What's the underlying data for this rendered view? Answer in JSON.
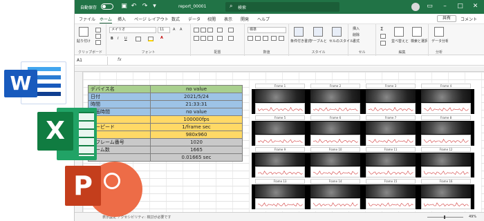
{
  "window": {
    "autosave_label": "自動保存",
    "autosave_state": "オフ",
    "filename": "report_00001",
    "search_placeholder": "検索",
    "share_label": "共有",
    "comment_label": "コメント"
  },
  "tabs": [
    "ファイル",
    "ホーム",
    "挿入",
    "ページ レイアウト",
    "数式",
    "データ",
    "校閲",
    "表示",
    "開発",
    "ヘルプ"
  ],
  "active_tab": "ホーム",
  "ribbon": {
    "clipboard": {
      "label": "クリップボード",
      "paste": "貼り付け"
    },
    "font": {
      "label": "フォント",
      "name": "メイリオ",
      "size": "11"
    },
    "alignment": {
      "label": "配置"
    },
    "number": {
      "label": "数値",
      "format": "標準"
    },
    "styles": {
      "label": "スタイル",
      "cond": "条件付き書式",
      "table": "テーブルとして書式設定",
      "cell": "セルのスタイル"
    },
    "cells": {
      "label": "セル",
      "insert": "挿入",
      "delete": "削除",
      "format": "書式"
    },
    "editing": {
      "label": "編集",
      "sort": "並べ替えとフィルター",
      "find": "検索と選択"
    },
    "analysis": {
      "label": "分析",
      "data": "データ分析"
    }
  },
  "name_box": "A1",
  "formula_symbol": "fx",
  "info_table": [
    {
      "key": "デバイス名",
      "value": "no value",
      "color": "#a9d08e"
    },
    {
      "key": "日付",
      "value": "2021/5/24",
      "color": "#9dc3e6"
    },
    {
      "key": "時間",
      "value": "21:33:31",
      "color": "#9dc3e6"
    },
    {
      "key": "録画時間",
      "value": "no value",
      "color": "#9dc3e6"
    },
    {
      "key": "度",
      "value": "100000fps",
      "color": "#ffd966"
    },
    {
      "key": "ターピード",
      "value": "1/frame sec",
      "color": "#ffd966"
    },
    {
      "key": "",
      "value": "980x960",
      "color": "#ffd966"
    },
    {
      "key": "トフレーム番号",
      "value": "1020",
      "color": "#c9c9c9"
    },
    {
      "key": "レーム数",
      "value": "1665",
      "color": "#c9c9c9"
    },
    {
      "key": "",
      "value": "0.01665 sec",
      "color": "#c9c9c9"
    }
  ],
  "frame_rows": [
    [
      "Frame 1",
      "Frame 2",
      "Frame 3",
      "Frame 4"
    ],
    [
      "Frame 5",
      "Frame 6",
      "Frame 7",
      "Frame 8"
    ],
    [
      "Frame 9",
      "Frame 10",
      "Frame 11",
      "Frame 12"
    ],
    [
      "Frame 13",
      "Frame 14",
      "Frame 15",
      "Frame 16"
    ]
  ],
  "status": {
    "text": "表示設定 アクセシビリティ: 検討が必要です",
    "zoom": "49%"
  },
  "logos": {
    "word": "W",
    "excel": "X",
    "powerpoint": "P"
  },
  "colors": {
    "excel_green": "#217346",
    "word_blue": "#185abd",
    "excel_dark": "#107c41",
    "ppt_red": "#c43e1c"
  }
}
